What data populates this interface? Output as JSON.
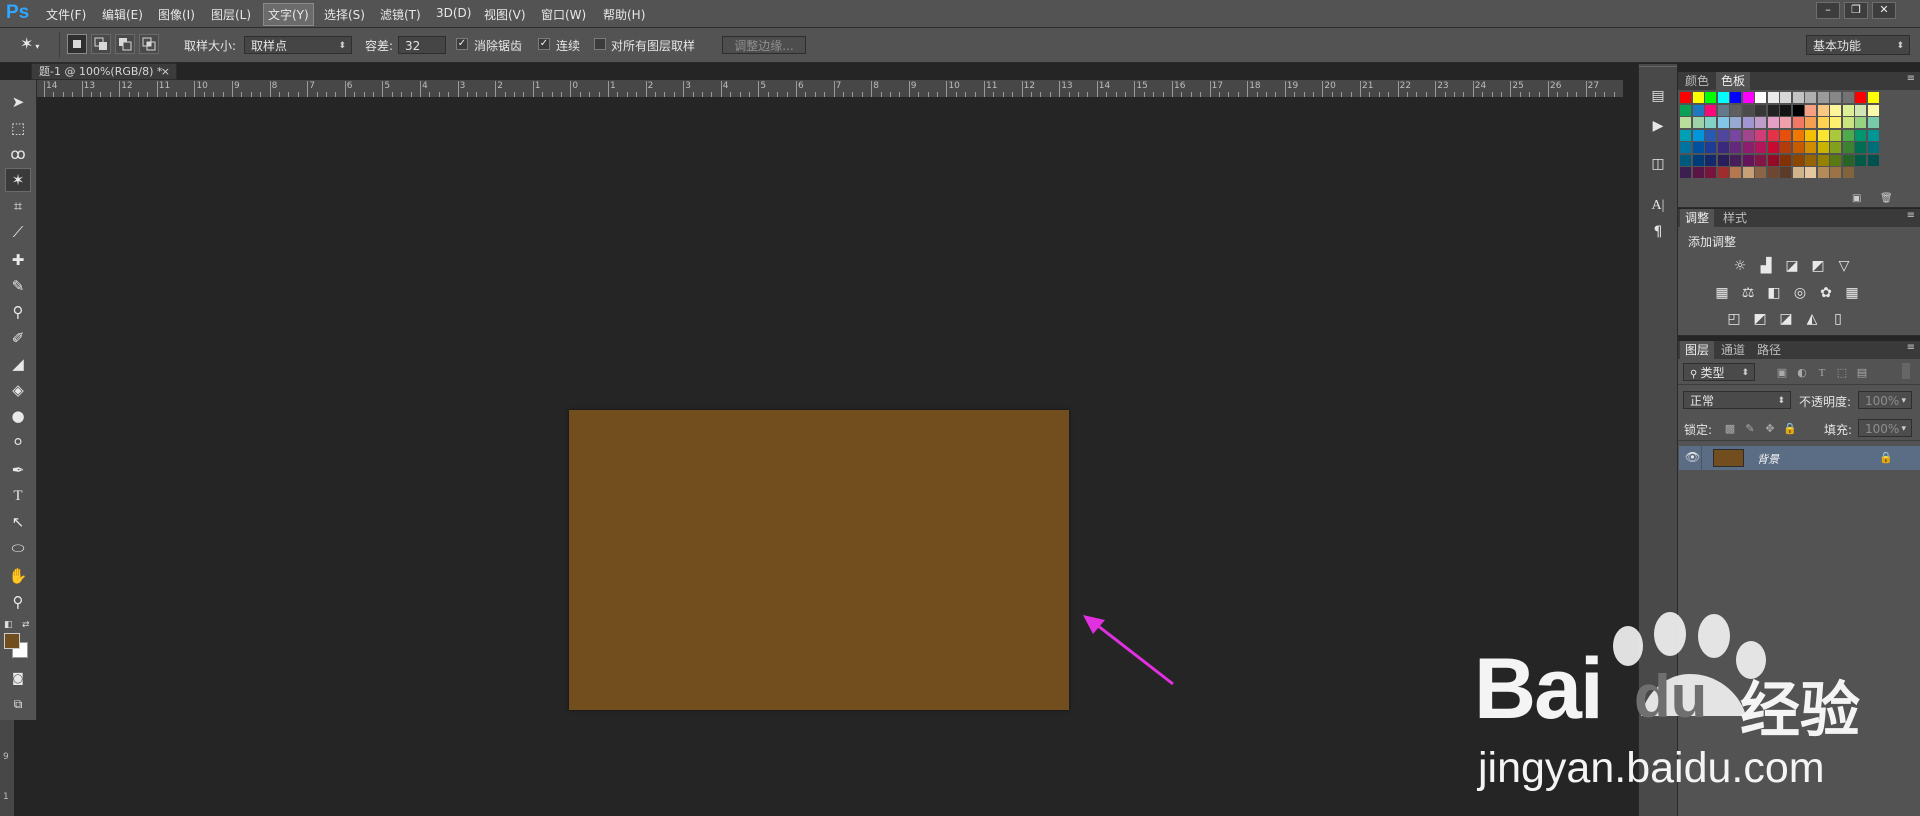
{
  "app": {
    "logo": "Ps",
    "menus": [
      "文件(F)",
      "编辑(E)",
      "图像(I)",
      "图层(L)",
      "文字(Y)",
      "选择(S)",
      "滤镜(T)",
      "3D(D)",
      "视图(V)",
      "窗口(W)",
      "帮助(H)"
    ],
    "active_menu": "文字(Y)",
    "window_buttons": [
      "–",
      "❐",
      "✕"
    ]
  },
  "options": {
    "sample_size_label": "取样大小:",
    "sample_size_value": "取样点",
    "tolerance_label": "容差:",
    "tolerance_value": "32",
    "antialias_label": "消除锯齿",
    "antialias_checked": true,
    "contiguous_label": "连续",
    "contiguous_checked": true,
    "all_layers_label": "对所有图层取样",
    "all_layers_checked": false,
    "refine_edge_label": "调整边缘...",
    "workspace_value": "基本功能"
  },
  "document": {
    "tab_title": "题-1 @ 100%(RGB/8) *",
    "close_symbol": "×",
    "fill_color": "#724d1e",
    "ruler_numbers": [
      "14",
      "13",
      "12",
      "11",
      "10",
      "9",
      "8",
      "7",
      "6",
      "5",
      "4",
      "3",
      "2",
      "1",
      "0",
      "1",
      "2",
      "3",
      "4",
      "5",
      "6",
      "7",
      "8",
      "9",
      "10",
      "11",
      "12",
      "13",
      "14",
      "15",
      "16",
      "17",
      "18",
      "19",
      "20",
      "21",
      "22",
      "23",
      "24",
      "25",
      "26",
      "27"
    ],
    "vruler_numbers": [
      "9",
      "1"
    ]
  },
  "tools": [
    "move-tool",
    "marquee-tool",
    "lasso-tool",
    "magic-wand-tool",
    "crop-tool",
    "eyedropper-tool",
    "healing-brush-tool",
    "brush-tool",
    "clone-stamp-tool",
    "history-brush-tool",
    "eraser-tool",
    "paint-bucket-tool",
    "blur-tool",
    "dodge-tool",
    "pen-tool",
    "type-tool",
    "path-selection-tool",
    "ellipse-tool",
    "hand-tool",
    "zoom-tool"
  ],
  "foreground_color": "#724d1e",
  "background_color": "#ffffff",
  "panels": {
    "color_tab": "颜色",
    "swatches_tab": "色板",
    "adjustments_tab": "调整",
    "styles_tab": "样式",
    "add_adjustment": "添加调整",
    "layers_tab": "图层",
    "channels_tab": "通道",
    "paths_tab": "路径",
    "filter_kind": "类型",
    "blend_mode": "正常",
    "opacity_label": "不透明度:",
    "opacity_value": "100%",
    "lock_label": "锁定:",
    "fill_label": "填充:",
    "fill_value": "100%",
    "layer_name": "背景"
  },
  "annotation": {
    "arrow_color": "#e030e0"
  },
  "watermark": {
    "brand_latin": "Bai",
    "brand_du": "du",
    "brand_cn": "经验",
    "url": "jingyan.baidu.com"
  }
}
